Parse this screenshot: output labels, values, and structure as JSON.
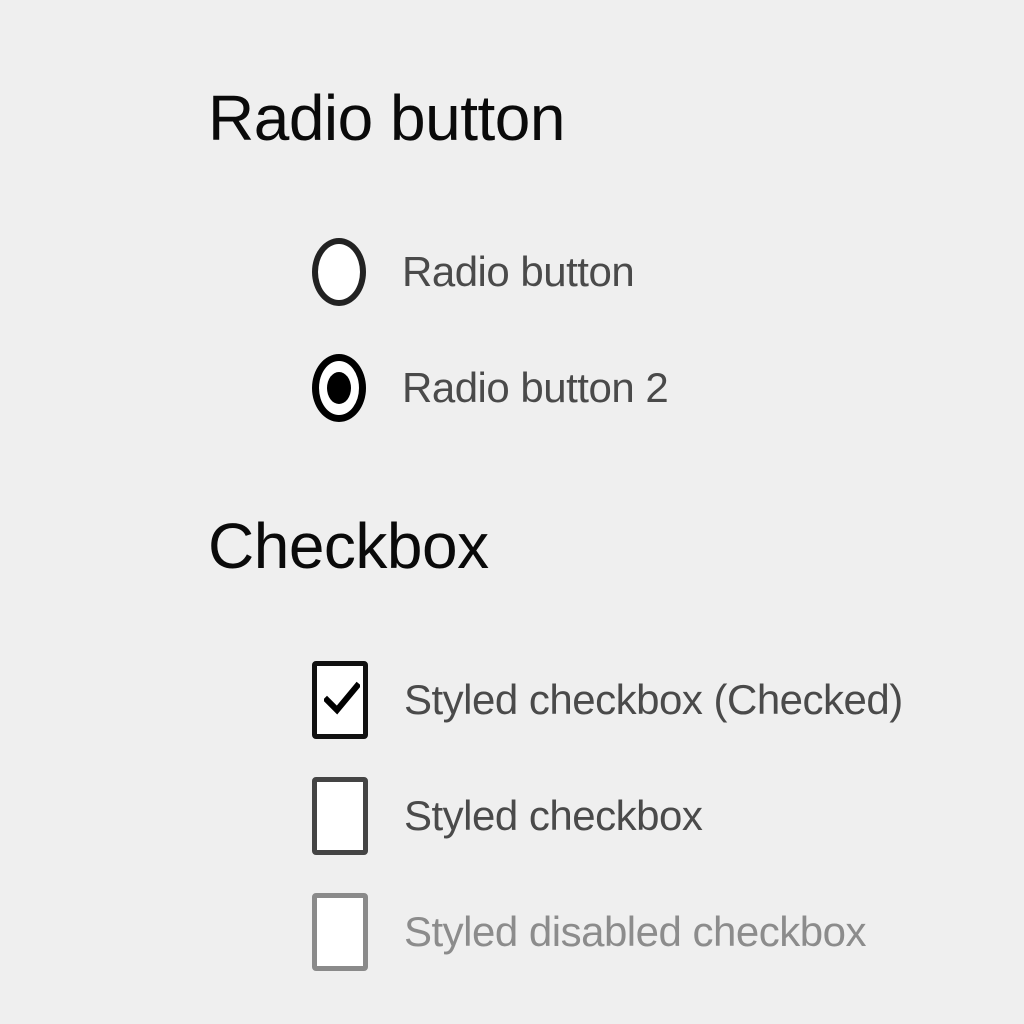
{
  "radio_section": {
    "heading": "Radio button",
    "options": [
      {
        "label": "Radio button",
        "checked": false
      },
      {
        "label": "Radio button 2",
        "checked": true
      }
    ]
  },
  "checkbox_section": {
    "heading": "Checkbox",
    "options": [
      {
        "label": "Styled checkbox (Checked)",
        "checked": true,
        "disabled": false
      },
      {
        "label": "Styled checkbox",
        "checked": false,
        "disabled": false
      },
      {
        "label": "Styled disabled checkbox",
        "checked": false,
        "disabled": true
      }
    ]
  },
  "colors": {
    "background": "#efefef",
    "heading_text": "#0a0a0a",
    "label_text": "#4a4a4a",
    "disabled_text": "#8c8c8c",
    "control_border": "#111111",
    "disabled_border": "#8a8a8a"
  },
  "icons": {
    "radio_unchecked": "radio-unchecked-icon",
    "radio_checked": "radio-checked-icon",
    "checkbox_checked": "checkmark-icon"
  }
}
